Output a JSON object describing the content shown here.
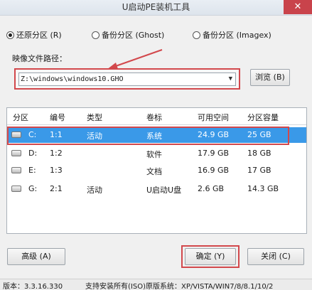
{
  "window": {
    "title": "U启动PE装机工具",
    "close_label": "✕"
  },
  "modes": [
    {
      "label": "还原分区 (R)",
      "selected": true
    },
    {
      "label": "备份分区 (Ghost)",
      "selected": false
    },
    {
      "label": "备份分区 (Imagex)",
      "selected": false
    }
  ],
  "image_path": {
    "label": "映像文件路径：",
    "value": "Z:\\windows\\windows10.GHO",
    "browse_label": "浏览 (B)"
  },
  "table": {
    "columns": [
      "分区",
      "编号",
      "类型",
      "卷标",
      "可用空间",
      "分区容量"
    ],
    "rows": [
      {
        "drive": "C:",
        "num": "1:1",
        "type": "活动",
        "label": "系统",
        "free": "24.9 GB",
        "size": "25 GB",
        "selected": true
      },
      {
        "drive": "D:",
        "num": "1:2",
        "type": "",
        "label": "软件",
        "free": "17.9 GB",
        "size": "18 GB",
        "selected": false
      },
      {
        "drive": "E:",
        "num": "1:3",
        "type": "",
        "label": "文档",
        "free": "16.9 GB",
        "size": "17 GB",
        "selected": false
      },
      {
        "drive": "G:",
        "num": "2:1",
        "type": "活动",
        "label": "U启动U盘",
        "free": "2.6 GB",
        "size": "14.3 GB",
        "selected": false
      }
    ]
  },
  "buttons": {
    "advanced": "高级 (A)",
    "ok": "确定 (Y)",
    "close": "关闭 (C)"
  },
  "status": {
    "version": "版本：3.3.16.330",
    "support": "支持安装所有(ISO)原版系统：XP/VISTA/WIN7/8/8.1/10/2"
  },
  "colors": {
    "highlight": "#d2484c",
    "selection": "#3a99e8"
  }
}
